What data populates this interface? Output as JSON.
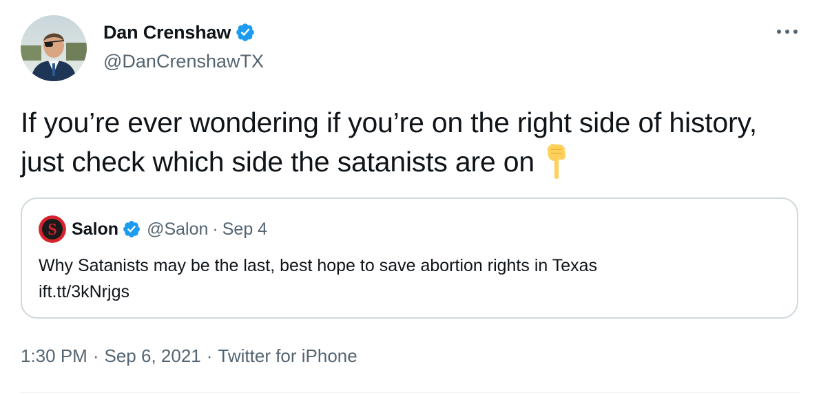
{
  "author": {
    "display_name": "Dan Crenshaw",
    "handle": "@DanCrenshawTX",
    "verified": true
  },
  "tweet": {
    "text": "If you’re ever wondering if you’re on the right side of history, just check which side the satanists are on",
    "emoji": "backhand-index-pointing-down"
  },
  "quoted_tweet": {
    "display_name": "Salon",
    "handle": "@Salon",
    "separator": "·",
    "date": "Sep 4",
    "text": "Why Satanists may be the last, best hope to save abortion rights in Texas",
    "link": "ift.tt/3kNrjgs"
  },
  "meta": {
    "time": "1:30 PM",
    "date": "Sep 6, 2021",
    "source": "Twitter for iPhone",
    "separator": "·"
  },
  "colors": {
    "verified_blue": "#1d9bf0",
    "secondary_text": "#536471",
    "border": "#cfd9de",
    "salon_red": "#d5232f"
  }
}
